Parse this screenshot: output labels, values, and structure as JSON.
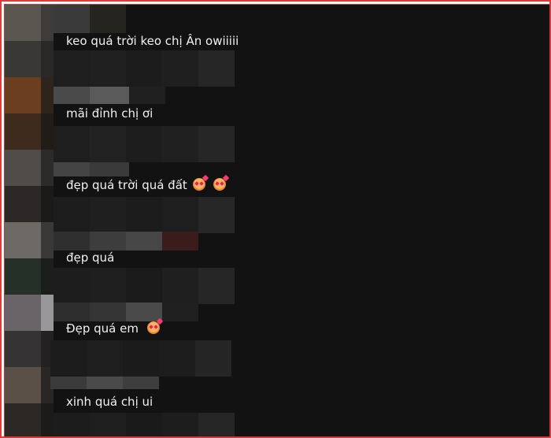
{
  "comments": [
    {
      "text": "keo quá trời keo chị Ân owiiiii",
      "emojis": []
    },
    {
      "text": "mãi đỉnh chị ơi",
      "emojis": []
    },
    {
      "text": "đẹp quá trời quá đất",
      "emojis": [
        "smiling-face-with-hearts",
        "smiling-face-with-hearts"
      ]
    },
    {
      "text": "đẹp quá",
      "emojis": []
    },
    {
      "text": "Đẹp quá em",
      "emojis": [
        "smiling-face-with-hearts"
      ]
    },
    {
      "text": "xinh quá chị ui",
      "emojis": []
    }
  ],
  "colors": {
    "background": "#121212",
    "text": "#f1f1f1",
    "frame_border": "#e23b3b"
  }
}
